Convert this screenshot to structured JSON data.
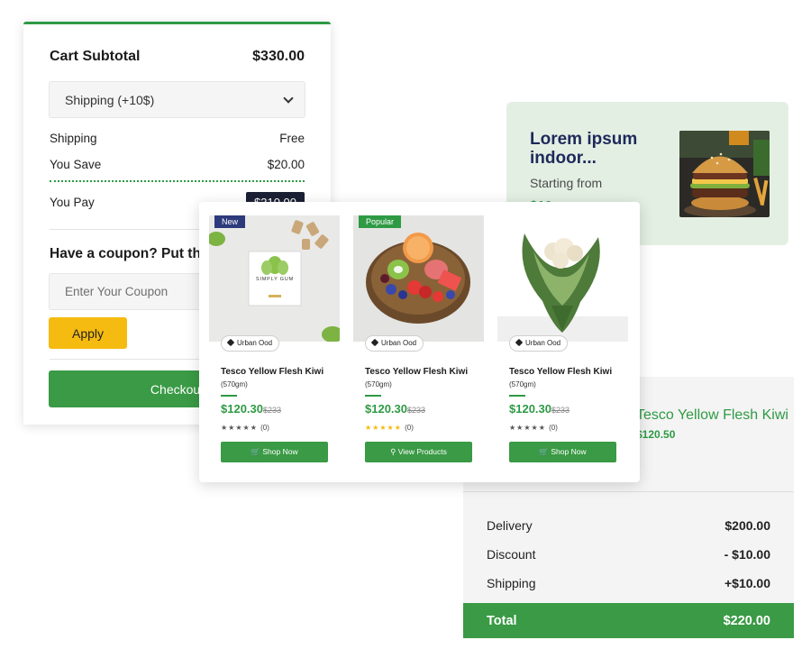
{
  "cart": {
    "subtotal_label": "Cart Subtotal",
    "subtotal_value": "$330.00",
    "shipping_select": "Shipping (+10$)",
    "shipping_label": "Shipping",
    "shipping_value": "Free",
    "save_label": "You Save",
    "save_value": "$20.00",
    "pay_label": "You Pay",
    "pay_value": "$310.00",
    "coupon_title": "Have a coupon? Put that here",
    "coupon_placeholder": "Enter Your Coupon",
    "apply_label": "Apply",
    "checkout_label": "Checkout"
  },
  "promo": {
    "title": "Lorem ipsum indoor...",
    "subtitle": "Starting from",
    "price": "$10"
  },
  "summary": {
    "product_name": "Tesco Yellow Flesh Kiwi",
    "product_price": "$120.50",
    "rows": [
      {
        "label": "Delivery",
        "value": "$200.00"
      },
      {
        "label": "Discount",
        "value": "- $10.00"
      },
      {
        "label": "Shipping",
        "value": "+$10.00"
      }
    ],
    "total_label": "Total",
    "total_value": "$220.00"
  },
  "products": [
    {
      "badge": "New",
      "badge_color": "#2d3a7c",
      "vendor": "Urban Ood",
      "name": "Tesco Yellow Flesh Kiwi",
      "weight": "(570gm)",
      "price": "$120.30",
      "old_price": "$233",
      "stars": "★★★★★",
      "rating_count": "(0)",
      "button": "Shop Now",
      "button_icon": "cart-icon",
      "image_label": "SIMPLY GUM"
    },
    {
      "badge": "Popular",
      "badge_color": "#2e9a44",
      "vendor": "Urban Ood",
      "name": "Tesco Yellow Flesh Kiwi",
      "weight": "(570gm)",
      "price": "$120.30",
      "old_price": "$233",
      "stars": "★★★★★",
      "rating_count": "(0)",
      "button": "View Products",
      "button_icon": "search-icon"
    },
    {
      "badge": "",
      "vendor": "Urban Ood",
      "name": "Tesco Yellow Flesh Kiwi",
      "weight": "(570gm)",
      "price": "$120.30",
      "old_price": "$233",
      "stars": "★★★★★",
      "rating_count": "(0)",
      "button": "Shop Now",
      "button_icon": "cart-icon"
    }
  ],
  "colors": {
    "accent_green": "#3a9a45",
    "apply_yellow": "#f6bb10",
    "navy": "#1e2a5a"
  }
}
